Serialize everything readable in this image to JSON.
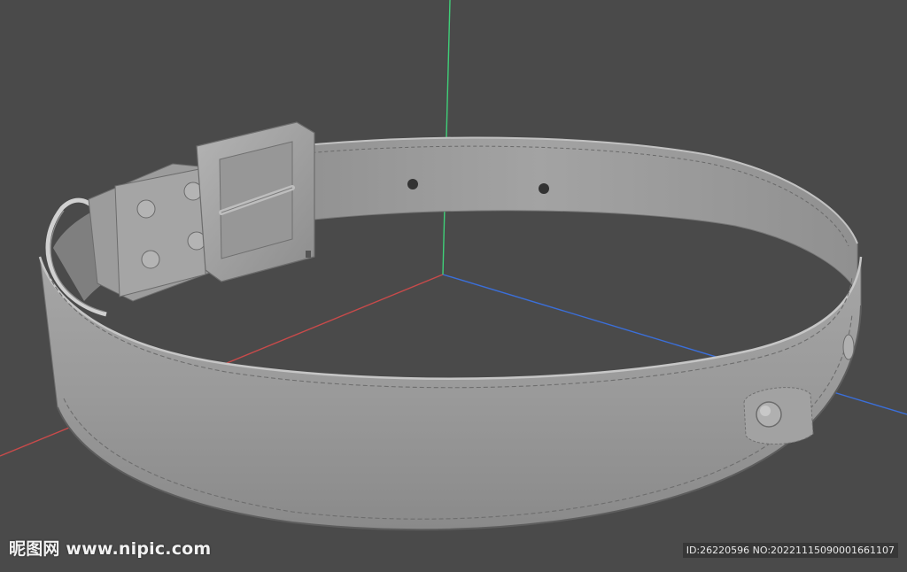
{
  "scene": {
    "background_color": "#4a4a4a",
    "belt_color": "#9d9d9d",
    "axis_colors": {
      "x": "#c94a4a",
      "y": "#3fcf78",
      "z": "#3b6fd9"
    }
  },
  "watermark": {
    "site": "昵图网 www.nipic.com",
    "id_text": "ID:26220596 NO:20221115090001661107"
  }
}
